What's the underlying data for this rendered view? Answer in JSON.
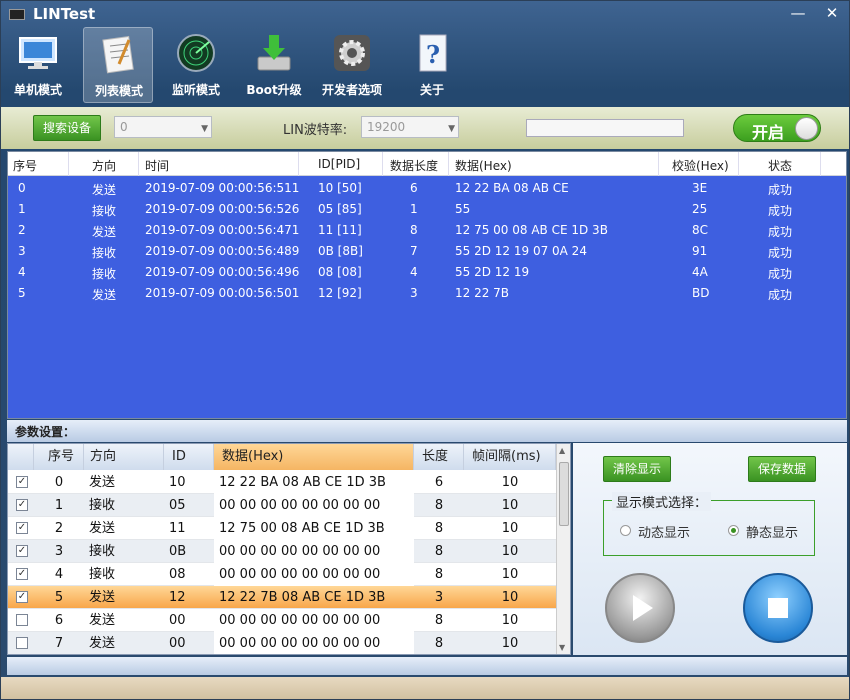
{
  "app": {
    "title": "LINTest",
    "minimize": "—",
    "close": "✕"
  },
  "toolbar": [
    {
      "label": "单机模式",
      "icon": "monitor-icon"
    },
    {
      "label": "列表模式",
      "icon": "notepad-icon",
      "active": true
    },
    {
      "label": "监听模式",
      "icon": "radar-icon"
    },
    {
      "label": "Boot升级",
      "icon": "disk-download-icon"
    },
    {
      "label": "开发者选项",
      "icon": "gear-icon"
    },
    {
      "label": "关于",
      "icon": "help-icon"
    }
  ],
  "opbar": {
    "search_device": "搜索设备",
    "device_value": "0",
    "baud_label": "LIN波特率:",
    "baud_value": "19200",
    "toggle_label": "开启"
  },
  "log": {
    "headers": [
      "序号",
      "方向",
      "时间",
      "ID[PID]",
      "数据长度",
      "数据(Hex)",
      "校验(Hex)",
      "状态"
    ],
    "rows": [
      [
        "0",
        "发送",
        "2019-07-09 00:00:56:511",
        "10 [50]",
        "6",
        "12 22 BA 08 AB CE",
        "3E",
        "成功"
      ],
      [
        "1",
        "接收",
        "2019-07-09 00:00:56:526",
        "05 [85]",
        "1",
        "55",
        "25",
        "成功"
      ],
      [
        "2",
        "发送",
        "2019-07-09 00:00:56:471",
        "11 [11]",
        "8",
        "12 75 00 08 AB CE 1D 3B",
        "8C",
        "成功"
      ],
      [
        "3",
        "接收",
        "2019-07-09 00:00:56:489",
        "0B [8B]",
        "7",
        "55 2D 12 19 07 0A 24",
        "91",
        "成功"
      ],
      [
        "4",
        "接收",
        "2019-07-09 00:00:56:496",
        "08 [08]",
        "4",
        "55 2D 12 19",
        "4A",
        "成功"
      ],
      [
        "5",
        "发送",
        "2019-07-09 00:00:56:501",
        "12 [92]",
        "3",
        "12 22 7B",
        "BD",
        "成功"
      ]
    ]
  },
  "params": {
    "title": "参数设置：",
    "headers": [
      "序号",
      "方向",
      "ID",
      "数据(Hex)",
      "长度",
      "帧间隔(ms)"
    ],
    "rows": [
      {
        "checked": true,
        "cells": [
          "0",
          "发送",
          "10",
          "12 22 BA 08 AB CE 1D 3B",
          "6",
          "10"
        ]
      },
      {
        "checked": true,
        "cells": [
          "1",
          "接收",
          "05",
          "00 00 00 00 00 00 00 00",
          "8",
          "10"
        ]
      },
      {
        "checked": true,
        "cells": [
          "2",
          "发送",
          "11",
          "12 75 00 08 AB CE 1D 3B",
          "8",
          "10"
        ]
      },
      {
        "checked": true,
        "cells": [
          "3",
          "接收",
          "0B",
          "00 00 00 00 00 00 00 00",
          "8",
          "10"
        ]
      },
      {
        "checked": true,
        "cells": [
          "4",
          "接收",
          "08",
          "00 00 00 00 00 00 00 00",
          "8",
          "10"
        ]
      },
      {
        "checked": true,
        "cells": [
          "5",
          "发送",
          "12",
          "12 22 7B 08 AB CE 1D 3B",
          "3",
          "10"
        ],
        "selected": true
      },
      {
        "checked": false,
        "cells": [
          "6",
          "发送",
          "00",
          "00 00 00 00 00 00 00 00",
          "8",
          "10"
        ]
      },
      {
        "checked": false,
        "cells": [
          "7",
          "发送",
          "00",
          "00 00 00 00 00 00 00 00",
          "8",
          "10"
        ]
      }
    ]
  },
  "controls": {
    "clear_label": "清除显示",
    "save_label": "保存数据",
    "mode_title": "显示模式选择：",
    "mode_dynamic": "动态显示",
    "mode_static": "静态显示",
    "mode_selected": "静态显示"
  },
  "colors": {
    "accent_green": "#3a9222",
    "log_bg": "#3e5fe0",
    "selected_row": "#f8a64a"
  }
}
